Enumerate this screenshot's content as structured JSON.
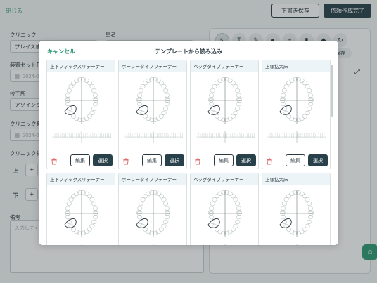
{
  "header": {
    "close_label": "閉じる",
    "save_draft_label": "下書き保存",
    "complete_label": "依頼作成完了"
  },
  "form": {
    "clinic_label": "クリニック",
    "clinic_value": "プレイス歯",
    "patient_label": "患者",
    "device_date_label": "装置セット日",
    "device_date_placeholder": "2024-0",
    "lab_label": "技工所",
    "lab_value": "アソインタ",
    "clinic_ship_label": "クリニック発",
    "clinic_ship_placeholder": "2024-0",
    "clinic_ref_label": "クリニック指",
    "upper_label": "上",
    "lower_label": "下",
    "notes_label": "備考",
    "notes_placeholder": "入力してく"
  },
  "canvas_panel": {
    "save_chip_label": "保存"
  },
  "modal": {
    "cancel_label": "キャンセル",
    "title": "テンプレートから読み込み",
    "edit_label": "編集",
    "select_label": "選択",
    "templates": [
      {
        "name": "上下フィックスリテーナー"
      },
      {
        "name": "ホーレータイプリテーナー"
      },
      {
        "name": "ベッグタイプリテーナー"
      },
      {
        "name": "上顎拡大床"
      },
      {
        "name": "上下フィックスリテーナー"
      },
      {
        "name": "ホーレータイプリテーナー"
      },
      {
        "name": "ベッグタイプリテーナー"
      },
      {
        "name": "上顎拡大床"
      }
    ]
  },
  "colors": {
    "accent_green": "#2e9a73",
    "primary_dark": "#27404a",
    "delete_red": "#e06b6b"
  }
}
